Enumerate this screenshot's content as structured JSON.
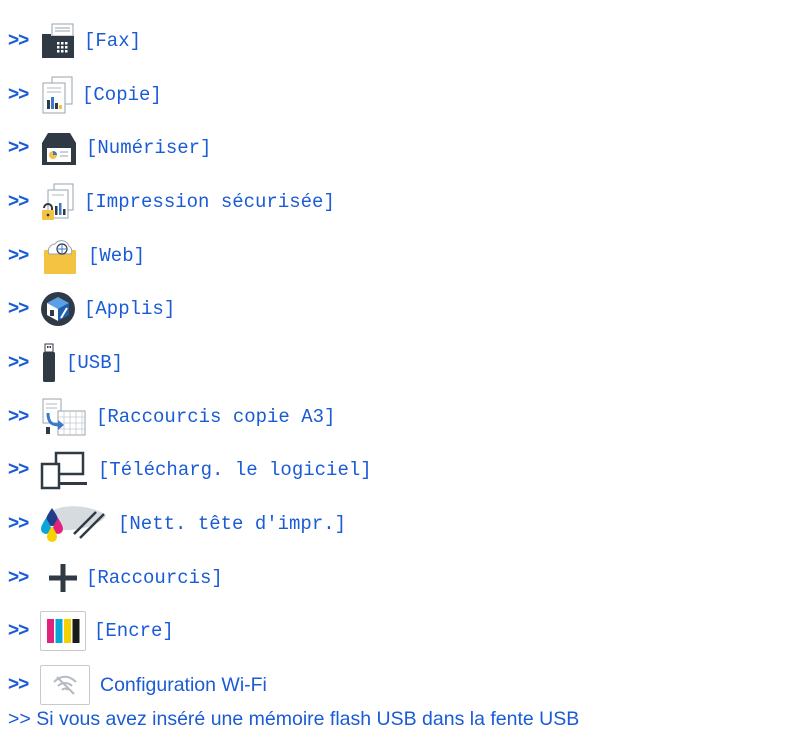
{
  "items": [
    {
      "arrow": ">>",
      "label": "[Fax]",
      "icon": "fax-icon"
    },
    {
      "arrow": ">>",
      "label": "[Copie]",
      "icon": "copy-icon"
    },
    {
      "arrow": ">>",
      "label": "[Numériser]",
      "icon": "scan-icon"
    },
    {
      "arrow": ">>",
      "label": "[Impression sécurisée]",
      "icon": "secure-print-icon"
    },
    {
      "arrow": ">>",
      "label": "[Web]",
      "icon": "web-icon"
    },
    {
      "arrow": ">>",
      "label": "[Applis]",
      "icon": "apps-icon"
    },
    {
      "arrow": ">>",
      "label": "[USB]",
      "icon": "usb-icon"
    },
    {
      "arrow": ">>",
      "label": "[Raccourcis copie A3]",
      "icon": "a3-copy-shortcut-icon"
    },
    {
      "arrow": ">>",
      "label": "[Télécharg. le logiciel]",
      "icon": "download-software-icon"
    },
    {
      "arrow": ">>",
      "label": "[Nett. tête d'impr.]",
      "icon": "print-head-cleaning-icon"
    },
    {
      "arrow": ">>",
      "label": "[Raccourcis]",
      "icon": "plus-icon"
    },
    {
      "arrow": ">>",
      "label": "[Encre]",
      "icon": "ink-icon"
    },
    {
      "arrow": ">>",
      "label": "Configuration Wi-Fi",
      "icon": "wifi-off-icon"
    }
  ],
  "footer_link": ">> Si vous avez inséré une mémoire flash USB dans la fente USB",
  "colors": {
    "link": "#1a5bd6",
    "icon_dark": "#2f3a45",
    "icon_blue": "#3a78c9",
    "icon_yellow": "#f5c342"
  }
}
